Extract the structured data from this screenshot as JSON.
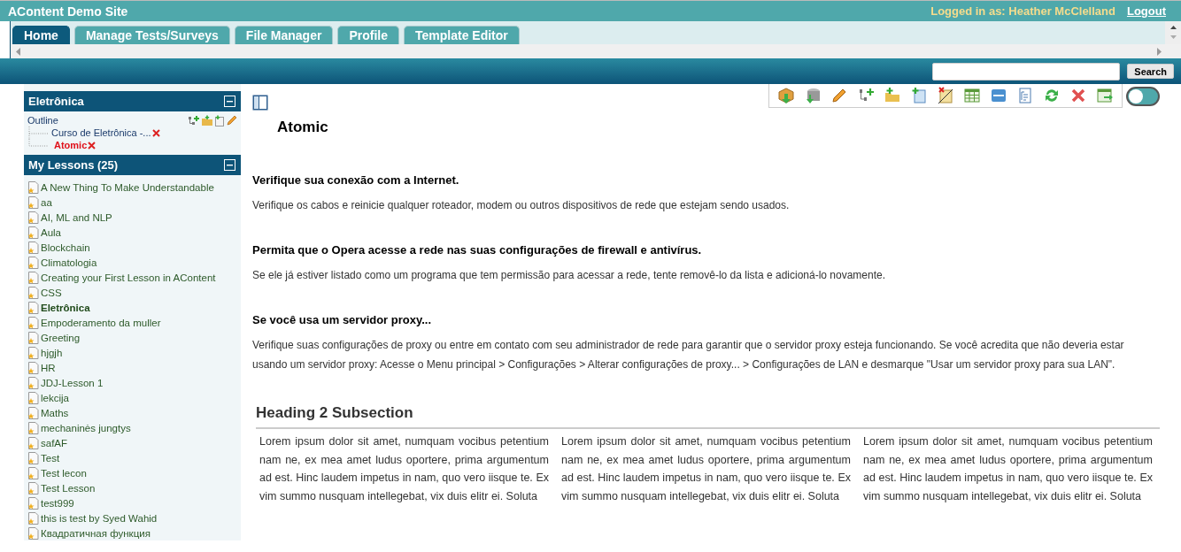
{
  "site_title": "AContent Demo Site",
  "user": {
    "logged_in_label": "Logged in as: Heather McClelland",
    "logout": "Logout"
  },
  "tabs": [
    {
      "label": "Home",
      "selected": true
    },
    {
      "label": "Manage Tests/Surveys",
      "selected": false
    },
    {
      "label": "File Manager",
      "selected": false
    },
    {
      "label": "Profile",
      "selected": false
    },
    {
      "label": "Template Editor",
      "selected": false
    }
  ],
  "search": {
    "button": "Search"
  },
  "outline_panel": {
    "title": "Eletrônica",
    "label": "Outline",
    "children": [
      {
        "label": "Curso de Eletrônica -...",
        "selected": false
      },
      {
        "label": "Atomic",
        "selected": true
      }
    ]
  },
  "lessons_panel": {
    "title": "My Lessons (25)",
    "items": [
      {
        "label": "A New Thing To Make Understandable",
        "selected": false
      },
      {
        "label": "aa",
        "selected": false
      },
      {
        "label": "AI, ML and NLP",
        "selected": false
      },
      {
        "label": "Aula",
        "selected": false
      },
      {
        "label": "Blockchain",
        "selected": false
      },
      {
        "label": "Climatologia",
        "selected": false
      },
      {
        "label": "Creating your First Lesson in AContent",
        "selected": false
      },
      {
        "label": "CSS",
        "selected": false
      },
      {
        "label": "Eletrônica",
        "selected": true
      },
      {
        "label": "Empoderamento da muller",
        "selected": false
      },
      {
        "label": "Greeting",
        "selected": false
      },
      {
        "label": "hjgjh",
        "selected": false
      },
      {
        "label": "HR",
        "selected": false
      },
      {
        "label": "JDJ-Lesson 1",
        "selected": false
      },
      {
        "label": "lekcija",
        "selected": false
      },
      {
        "label": "Maths",
        "selected": false
      },
      {
        "label": "mechaninės jungtys",
        "selected": false
      },
      {
        "label": "safAF",
        "selected": false
      },
      {
        "label": "Test",
        "selected": false
      },
      {
        "label": "Test lecon",
        "selected": false
      },
      {
        "label": "Test Lesson",
        "selected": false
      },
      {
        "label": "test999",
        "selected": false
      },
      {
        "label": "this is test by Syed Wahid",
        "selected": false
      },
      {
        "label": "Квадратичная функция",
        "selected": false
      }
    ]
  },
  "toolbar": {
    "toggle": {
      "on": false
    }
  },
  "content": {
    "title": "Atomic",
    "sections": [
      {
        "heading": "Verifique sua conexão com a Internet.",
        "text": "Verifique os cabos e reinicie qualquer roteador, modem ou outros dispositivos de rede que estejam sendo usados."
      },
      {
        "heading": "Permita que o Opera acesse a rede nas suas configurações de firewall e antivírus.",
        "text": "Se ele já estiver listado como um programa que tem permissão para acessar a rede, tente removê-lo da lista e adicioná-lo novamente."
      },
      {
        "heading": "Se você usa um servidor proxy...",
        "text": "Verifique suas configurações de proxy ou entre em contato com seu administrador de rede para garantir que o servidor proxy esteja funcionando. Se você acredita que não deveria estar usando um servidor proxy: Acesse o Menu principal > Configurações > Alterar configurações de proxy... > Configurações de LAN e desmarque \"Usar um servidor proxy para sua LAN\"."
      }
    ],
    "subheading": "Heading 2 Subsection",
    "columns": [
      "Lorem ipsum dolor sit amet, numquam vocibus petentium nam ne, ex mea amet ludus oportere, prima argumentum ad est. Hinc laudem impetus in nam, quo vero iisque te. Ex vim summo nusquam intellegebat, vix duis elitr ei. Soluta",
      "Lorem ipsum dolor sit amet, numquam vocibus petentium nam ne, ex mea amet ludus oportere, prima argumentum ad est. Hinc laudem impetus in nam, quo vero iisque te. Ex vim summo nusquam intellegebat, vix duis elitr ei. Soluta",
      "Lorem ipsum dolor sit amet, numquam vocibus petentium nam ne, ex mea amet ludus oportere, prima argumentum ad est. Hinc laudem impetus in nam, quo vero iisque te. Ex vim summo nusquam intellegebat, vix duis elitr ei. Soluta"
    ]
  }
}
